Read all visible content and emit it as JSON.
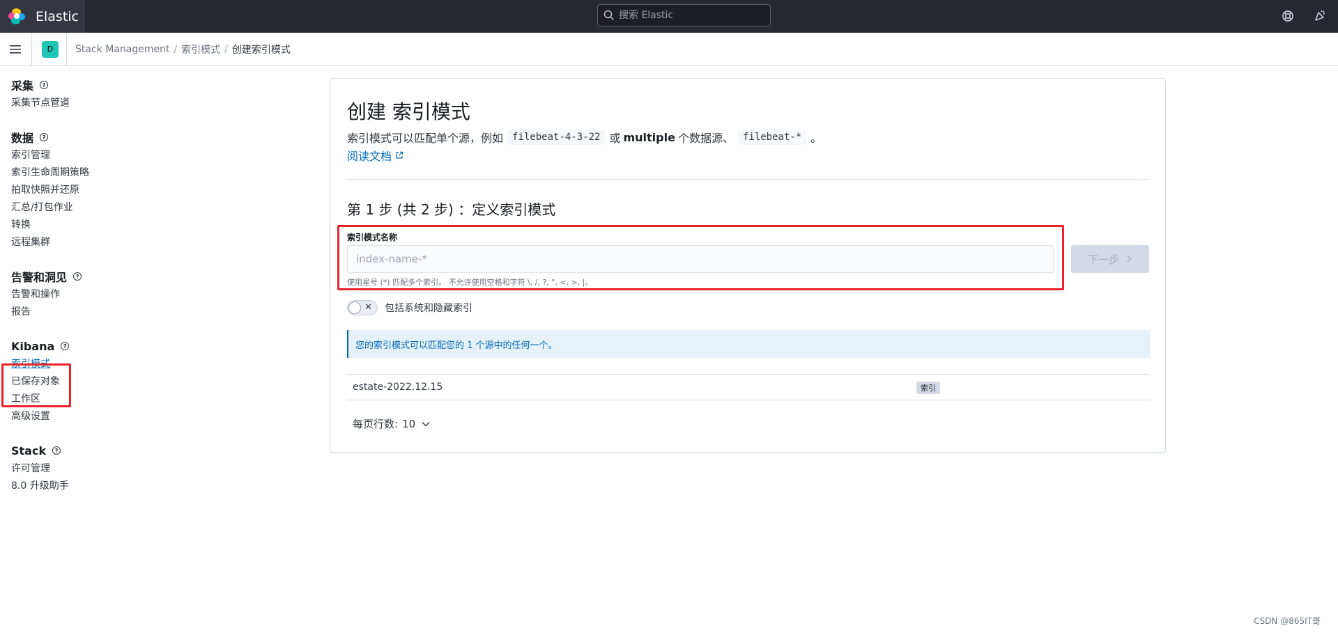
{
  "header": {
    "app_name": "Elastic",
    "search_placeholder": "搜索 Elastic"
  },
  "breadcrumbs": {
    "space_initial": "D",
    "items": [
      "Stack Management",
      "索引模式",
      "创建索引模式"
    ],
    "separator": "/"
  },
  "sidebar": {
    "groups": [
      {
        "heading": "采集",
        "items": [
          "采集节点管道"
        ]
      },
      {
        "heading": "数据",
        "items": [
          "索引管理",
          "索引生命周期策略",
          "拍取快照并还原",
          "汇总/打包作业",
          "转换",
          "远程集群"
        ]
      },
      {
        "heading": "告警和洞见",
        "items": [
          "告警和操作",
          "报告"
        ]
      },
      {
        "heading": "Kibana",
        "items": [
          "索引模式",
          "已保存对象",
          "工作区",
          "高级设置"
        ]
      },
      {
        "heading": "Stack",
        "items": [
          "许可管理",
          "8.0 升级助手"
        ]
      }
    ],
    "active_item": "索引模式"
  },
  "main": {
    "title": "创建 索引模式",
    "desc_prefix": "索引模式可以匹配单个源，例如",
    "desc_code1": "filebeat-4-3-22",
    "desc_or": "或",
    "desc_bold": "multiple",
    "desc_middle": "个数据源、",
    "desc_code2": "filebeat-*",
    "desc_end": "。",
    "doc_link": "阅读文档",
    "step_title": "第 1 步 (共 2 步) ：定义索引模式",
    "field_label": "索引模式名称",
    "field_placeholder": "index-name-*",
    "field_help": "使用星号 (*) 匹配多个索引。 不允许使用空格和字符 \\, /, ?, \", <, >, |。",
    "next_button": "下一步",
    "toggle_label": "包括系统和隐藏索引",
    "callout": "您的索引模式可以匹配您的 1 个源中的任何一个。",
    "rows": [
      {
        "name": "estate-2022.12.15",
        "badge": "索引"
      }
    ],
    "pager_label": "每页行数:",
    "pager_value": "10"
  },
  "watermark": "CSDN @865IT哥",
  "colors": {
    "header_bg": "#25282f",
    "accent_link": "#006bb8",
    "highlight_box": "#e8232a",
    "space_avatar": "#20c5b5"
  }
}
